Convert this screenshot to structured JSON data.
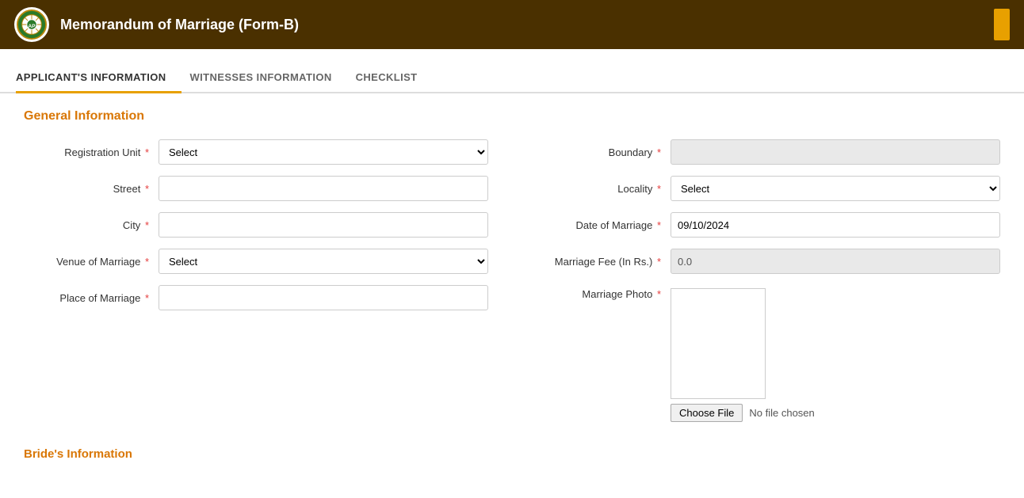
{
  "header": {
    "title": "Memorandum of Marriage (Form-B)",
    "logo_alt": "Government Logo"
  },
  "tabs": [
    {
      "id": "applicant",
      "label": "APPLICANT'S INFORMATION",
      "active": true
    },
    {
      "id": "witnesses",
      "label": "WITNESSES INFORMATION",
      "active": false
    },
    {
      "id": "checklist",
      "label": "CHECKLIST",
      "active": false
    }
  ],
  "general_info": {
    "section_title": "General Information",
    "fields": {
      "registration_unit_label": "Registration Unit",
      "registration_unit_placeholder": "Select",
      "boundary_label": "Boundary",
      "boundary_value": "",
      "street_label": "Street",
      "street_value": "",
      "locality_label": "Locality",
      "locality_placeholder": "Select",
      "city_label": "City",
      "city_value": "",
      "date_of_marriage_label": "Date of Marriage",
      "date_of_marriage_value": "09/10/2024",
      "venue_of_marriage_label": "Venue of Marriage",
      "venue_placeholder": "Select",
      "marriage_fee_label": "Marriage Fee (In Rs.)",
      "marriage_fee_value": "0.0",
      "place_of_marriage_label": "Place of Marriage",
      "place_of_marriage_value": "",
      "marriage_photo_label": "Marriage Photo",
      "choose_file_label": "Choose File",
      "no_file_text": "No file chosen"
    }
  },
  "bride_section": {
    "hint": "Bride's Information"
  },
  "required_symbol": "*",
  "colors": {
    "header_bg": "#4a3000",
    "accent_orange": "#d97706",
    "tab_active_border": "#e8a000",
    "required_red": "#e53e3e"
  }
}
